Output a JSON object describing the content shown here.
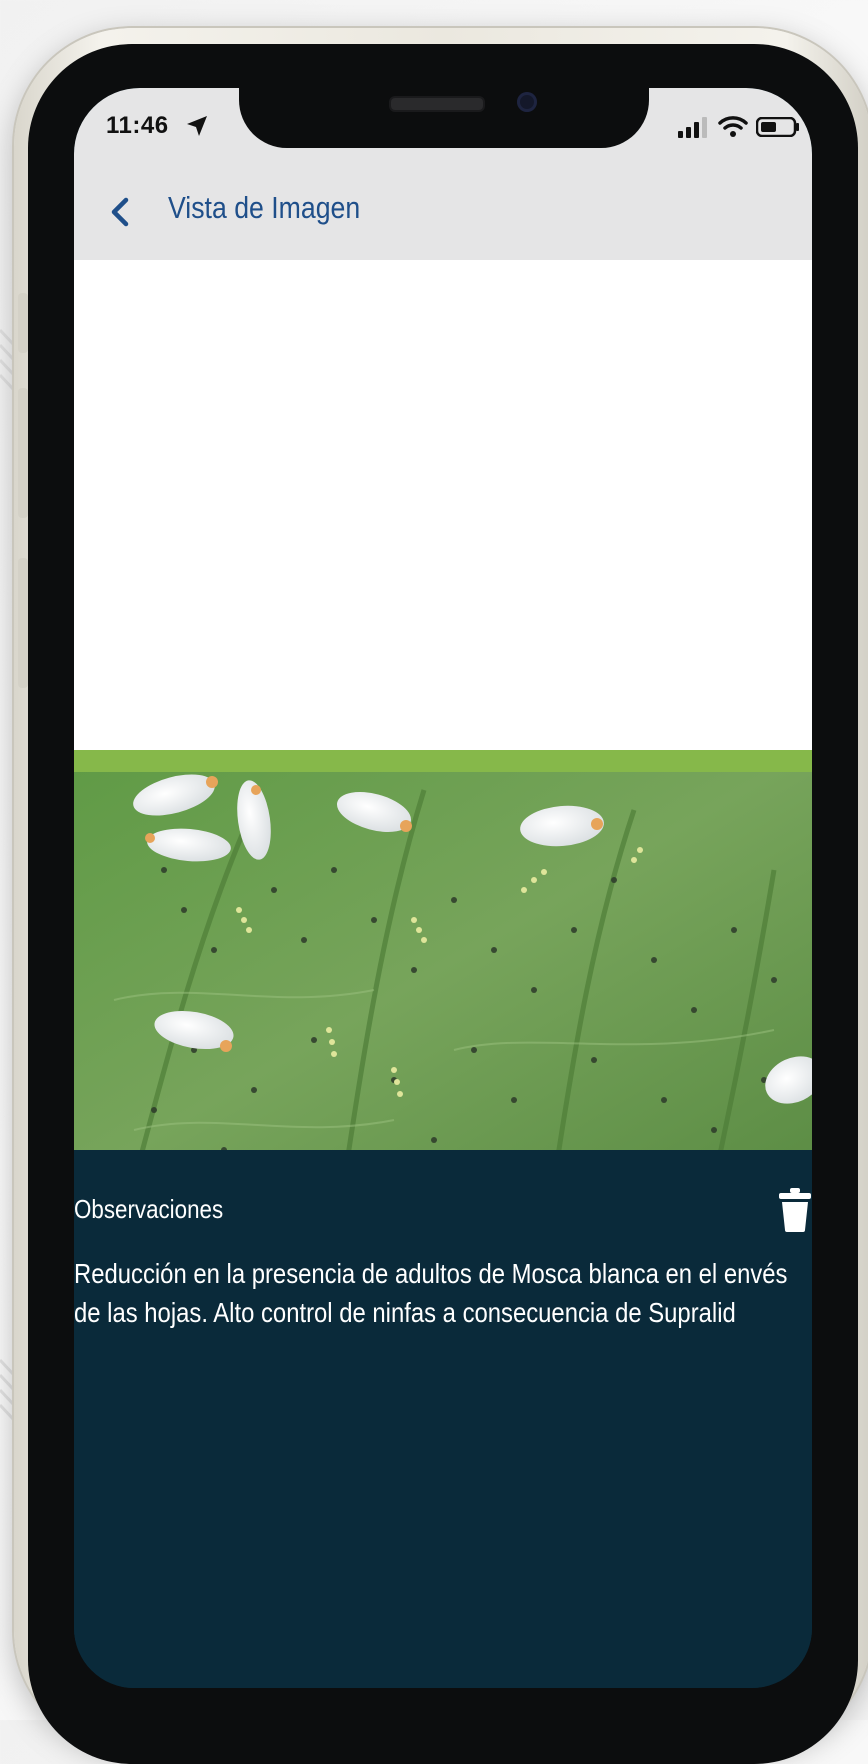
{
  "status_bar": {
    "time": "11:46"
  },
  "nav": {
    "title": "Vista de Imagen"
  },
  "observations": {
    "label": "Observaciones",
    "text": "Reducción en la presencia de adultos de Mosca blanca en el envés de las hojas.  Alto control de ninfas a consecuencia de Supralid"
  },
  "colors": {
    "nav_background": "#e5e5e6",
    "nav_accent": "#1f4f8a",
    "observations_background": "#0a2a3a",
    "image_background": "#ffffff"
  },
  "icons": {
    "back": "chevron-left-icon",
    "location": "location-arrow-icon",
    "signal": "signal-icon",
    "wifi": "wifi-icon",
    "battery": "battery-icon",
    "delete": "trash-icon"
  }
}
